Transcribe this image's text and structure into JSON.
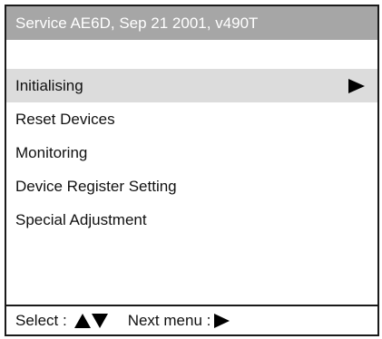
{
  "title": "Service AE6D, Sep 21 2001, v490T",
  "menu": {
    "items": [
      {
        "label": "Initialising",
        "selected": true,
        "icon": "arrow-right-icon"
      },
      {
        "label": "Reset Devices",
        "selected": false
      },
      {
        "label": "Monitoring",
        "selected": false
      },
      {
        "label": "Device Register Setting",
        "selected": false
      },
      {
        "label": "Special Adjustment",
        "selected": false
      }
    ]
  },
  "status": {
    "select_label": "Select :",
    "select_icons": [
      "up-triangle-icon",
      "down-triangle-icon"
    ],
    "next_label": "Next menu :",
    "next_icon": "right-triangle-icon"
  },
  "colors": {
    "title_bar_bg": "#a6a6a6",
    "title_text": "#ffffff",
    "selected_row_bg": "#dcdcdc",
    "border": "#1a1a1a"
  }
}
